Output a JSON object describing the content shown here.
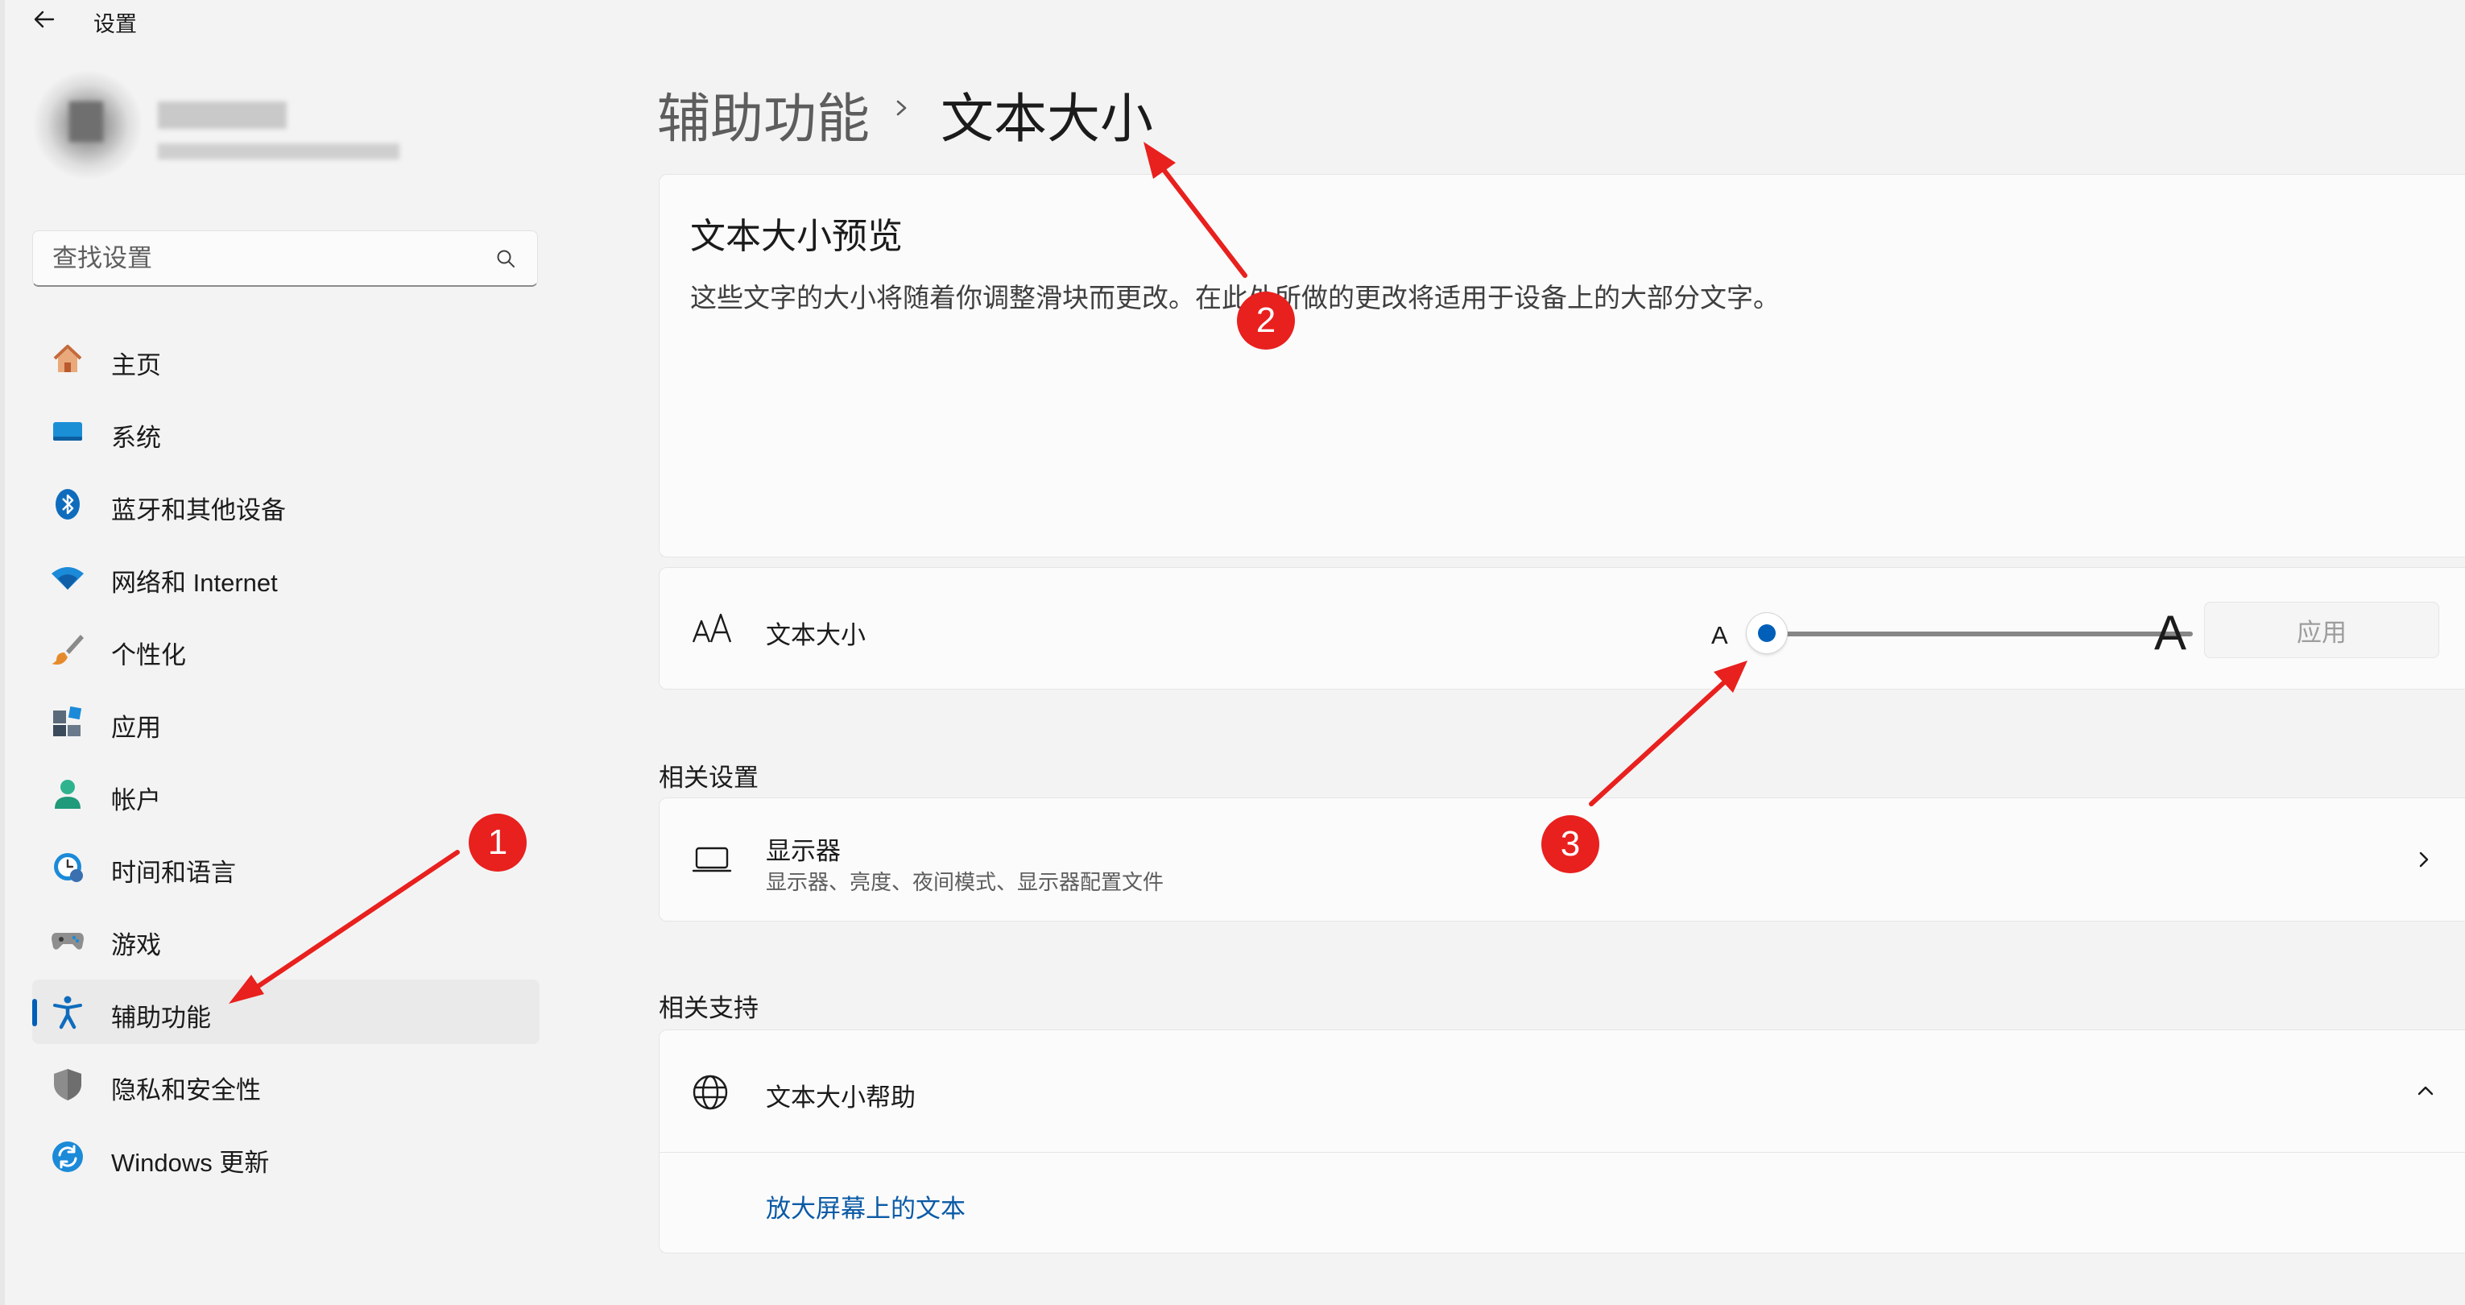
{
  "window": {
    "title": "设置"
  },
  "search": {
    "placeholder": "查找设置"
  },
  "nav": {
    "items": [
      {
        "label": "主页",
        "icon": "home-icon"
      },
      {
        "label": "系统",
        "icon": "system-icon"
      },
      {
        "label": "蓝牙和其他设备",
        "icon": "bluetooth-icon"
      },
      {
        "label": "网络和 Internet",
        "icon": "wifi-icon"
      },
      {
        "label": "个性化",
        "icon": "brush-icon"
      },
      {
        "label": "应用",
        "icon": "apps-icon"
      },
      {
        "label": "帐户",
        "icon": "account-icon"
      },
      {
        "label": "时间和语言",
        "icon": "time-language-icon"
      },
      {
        "label": "游戏",
        "icon": "gamepad-icon"
      },
      {
        "label": "辅助功能",
        "icon": "accessibility-icon",
        "selected": true
      },
      {
        "label": "隐私和安全性",
        "icon": "shield-icon"
      },
      {
        "label": "Windows 更新",
        "icon": "windows-update-icon"
      }
    ]
  },
  "header": {
    "parent": "辅助功能",
    "current": "文本大小"
  },
  "preview": {
    "title": "文本大小预览",
    "text": "这些文字的大小将随着你调整滑块而更改。在此处所做的更改将适用于设备上的大部分文字。"
  },
  "text_size": {
    "label": "文本大小",
    "small_a": "A",
    "large_a": "A",
    "slider_value_percent": 100,
    "slider_min_percent": 100,
    "slider_max_percent": 225,
    "apply_label": "应用"
  },
  "related_settings": {
    "title": "相关设置",
    "display": {
      "title": "显示器",
      "subtitle": "显示器、亮度、夜间模式、显示器配置文件"
    }
  },
  "related_support": {
    "title": "相关支持",
    "help": {
      "title": "文本大小帮助",
      "link": "放大屏幕上的文本"
    }
  },
  "annotations": [
    "1",
    "2",
    "3"
  ],
  "colors": {
    "accent": "#005fb8",
    "annotation": "#e8201e",
    "background": "#f3f3f3",
    "card": "#fbfbfb"
  }
}
